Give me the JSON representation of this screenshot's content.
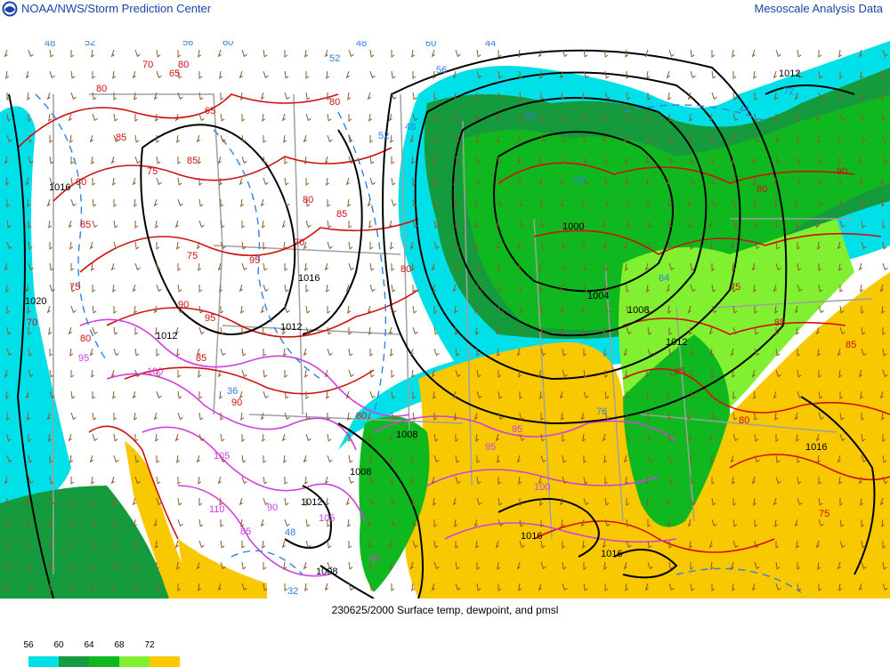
{
  "header": {
    "left_title": "NOAA/NWS/Storm Prediction Center",
    "right_title": "Mesoscale Analysis Data",
    "logo_icon": "noaa-logo-icon"
  },
  "caption": "230625/2000 Surface temp, dewpoint, and pmsl",
  "legend": {
    "labels": [
      "56",
      "60",
      "64",
      "68",
      "72"
    ],
    "colors": [
      "#00e0e8",
      "#169a3e",
      "#10b820",
      "#80f030",
      "#f8c800"
    ]
  },
  "map": {
    "colors": {
      "temperature_contour": "#d01010",
      "hot_temperature_contour": "#d040e0",
      "pressure_isobar": "#000000",
      "state_border": "#a0a0a0",
      "wind_barb": "#8b5a2b",
      "dashed_line": "#3080e0"
    },
    "isobar_labels": [
      {
        "text": "1012",
        "cls": "isobar-label"
      },
      {
        "text": "1016",
        "cls": "isobar-label"
      },
      {
        "text": "1020",
        "cls": "isobar-label"
      },
      {
        "text": "1012",
        "cls": "isobar-label"
      },
      {
        "text": "1016",
        "cls": "isobar-label"
      },
      {
        "text": "1012",
        "cls": "isobar-label"
      },
      {
        "text": "1000",
        "cls": "isobar-label"
      },
      {
        "text": "1004",
        "cls": "isobar-label"
      },
      {
        "text": "1008",
        "cls": "isobar-label"
      },
      {
        "text": "1012",
        "cls": "isobar-label"
      },
      {
        "text": "1008",
        "cls": "isobar-label"
      },
      {
        "text": "1008",
        "cls": "isobar-label"
      },
      {
        "text": "1012",
        "cls": "isobar-label"
      },
      {
        "text": "1016",
        "cls": "isobar-label"
      },
      {
        "text": "1016",
        "cls": "isobar-label"
      },
      {
        "text": "1016",
        "cls": "isobar-label"
      },
      {
        "text": "1008",
        "cls": "isobar-label"
      },
      {
        "text": "1012",
        "cls": "isobar-label"
      }
    ],
    "temperature_labels": [
      "70",
      "65",
      "80",
      "85",
      "80",
      "65",
      "85",
      "75",
      "80",
      "85",
      "80",
      "75",
      "70",
      "80",
      "85",
      "95",
      "80",
      "75",
      "70",
      "80",
      "90",
      "95",
      "85",
      "90",
      "80",
      "85",
      "75",
      "80",
      "85",
      "90",
      "85",
      "80",
      "75"
    ],
    "hot_labels": [
      "95",
      "100",
      "105",
      "110",
      "90",
      "95",
      "100",
      "85",
      "90",
      "105",
      "95"
    ],
    "dewpoint_labels": [
      "48",
      "52",
      "56",
      "60",
      "44",
      "52",
      "48",
      "56",
      "52",
      "48",
      "44",
      "56",
      "60",
      "68",
      "64",
      "72",
      "76",
      "36",
      "32",
      "48"
    ]
  }
}
